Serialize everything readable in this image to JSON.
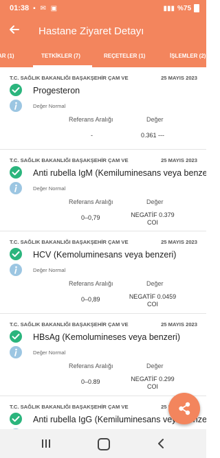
{
  "status_bar": {
    "time": "01:38",
    "battery": "%75"
  },
  "header": {
    "title": "Hastane Ziyaret Detayı"
  },
  "tabs": [
    {
      "label": "AR (1)"
    },
    {
      "label": "TETKİKLER (7)",
      "active": true
    },
    {
      "label": "REÇETELER (1)"
    },
    {
      "label": "İŞLEMLER (2)"
    }
  ],
  "columns": {
    "reference": "Referans Aralığı",
    "value": "Değer"
  },
  "results": [
    {
      "institution": "T.C. SAĞLIK BAKANLIĞI BAŞAKŞEHİR ÇAM VE",
      "date": "25 MAYIS 2023",
      "test": "Progesteron",
      "status": "Değer Normal",
      "reference": "-",
      "value_line1": "0.361 ---",
      "value_line2": ""
    },
    {
      "institution": "T.C. SAĞLIK BAKANLIĞI BAŞAKŞEHİR ÇAM VE",
      "date": "25 MAYIS 2023",
      "test": "Anti rubella IgM (Kemiluminesans veya benzeri)",
      "status": "Değer Normal",
      "reference": "0–0,79",
      "value_line1": "NEGATİF 0.379",
      "value_line2": "COI"
    },
    {
      "institution": "T.C. SAĞLIK BAKANLIĞI BAŞAKŞEHİR ÇAM VE",
      "date": "25 MAYIS 2023",
      "test": "HCV (Kemoluminesans veya benzeri)",
      "status": "Değer Normal",
      "reference": "0–0,89",
      "value_line1": "NEGATİF 0.0459",
      "value_line2": "COI"
    },
    {
      "institution": "T.C. SAĞLIK BAKANLIĞI BAŞAKŞEHİR ÇAM VE",
      "date": "25 MAYIS 2023",
      "test": "HBsAg (Kemolumineses veya benzeri)",
      "status": "Değer Normal",
      "reference": "0–0.89",
      "value_line1": "NEGATİF 0.299",
      "value_line2": "COI"
    },
    {
      "institution": "T.C. SAĞLIK BAKANLIĞI BAŞAKŞEHİR ÇAM VE",
      "date": "25 MAYIS 2023",
      "test": "Anti rubella IgG (Kemiluminesans veya benzeri)",
      "status": "",
      "reference": "",
      "value_line1": "",
      "value_line2": ""
    }
  ],
  "colors": {
    "accent": "#f3855d",
    "check": "#2bb57d",
    "info": "#9cc6e2"
  },
  "icons": {
    "back": "arrow-left-icon",
    "done": "check-circle-icon",
    "info": "info-icon",
    "share": "share-icon"
  }
}
